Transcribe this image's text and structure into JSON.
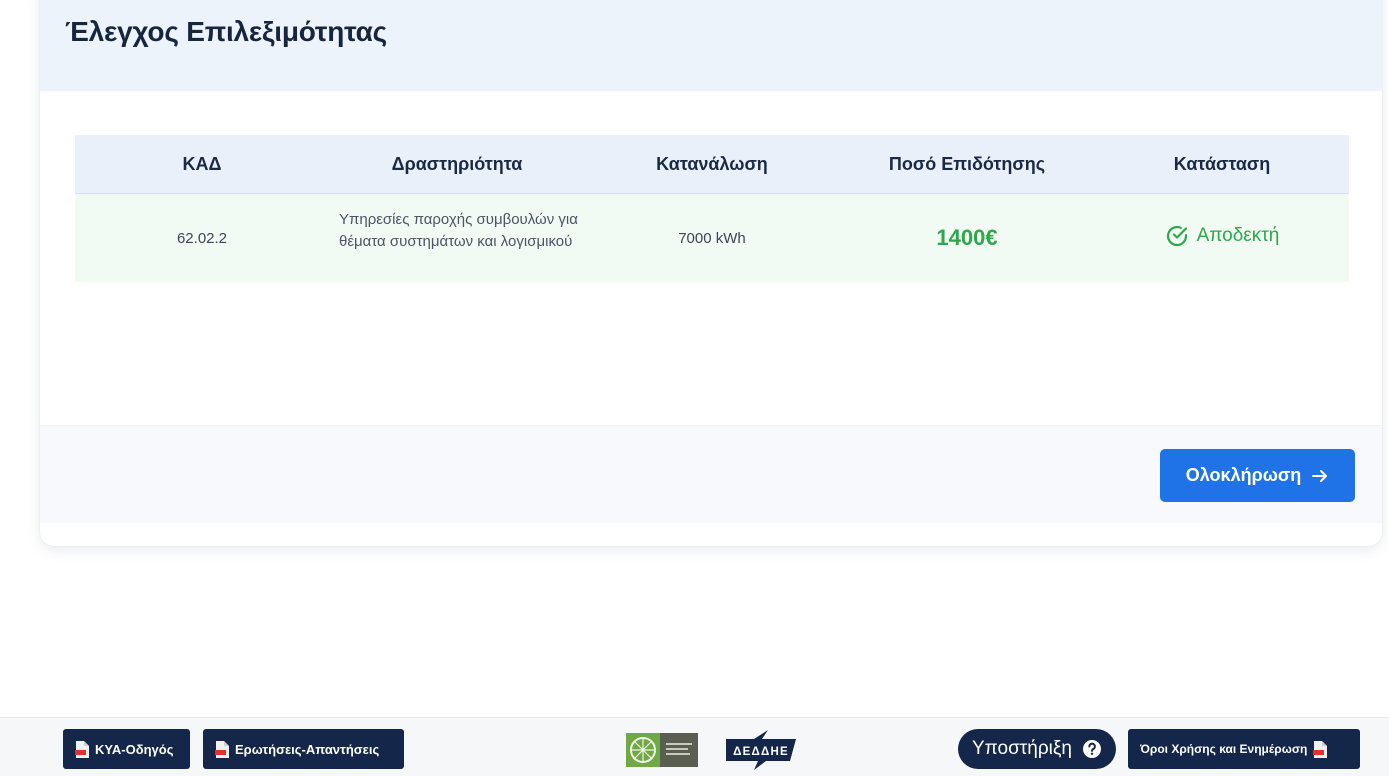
{
  "page": {
    "title": "Έλεγχος Επιλεξιμότητας"
  },
  "table": {
    "headers": [
      "ΚΑΔ",
      "Δραστηριότητα",
      "Κατανάλωση",
      "Ποσό Επιδότησης",
      "Κατάσταση"
    ],
    "rows": [
      {
        "kad": "62.02.2",
        "activity": "Υπηρεσίες παροχής συμβουλών για θέματα συστημάτων και λογισμικού",
        "consumption": "7000 kWh",
        "amount": "1400€",
        "status": "Αποδεκτή"
      }
    ]
  },
  "actions": {
    "complete_label": "Ολοκλήρωση"
  },
  "footer": {
    "kya_label": "ΚΥΑ-Οδηγός",
    "faq_label": "Ερωτήσεις-Απαντήσεις",
    "deddie_logo_text": "ΔΕΔΔΗΕ",
    "support_label": "Υποστήριξη",
    "terms_label": "Όροι Χρήσης και Ενημέρωση"
  },
  "colors": {
    "primary_blue": "#1f73e6",
    "navy": "#14264a",
    "success_green": "#2ea84a",
    "header_bg": "#edf3fb"
  },
  "icons": {
    "status": "check-circle-icon",
    "complete": "arrow-right-icon",
    "support": "question-circle-icon",
    "documents": "pdf-icon"
  }
}
